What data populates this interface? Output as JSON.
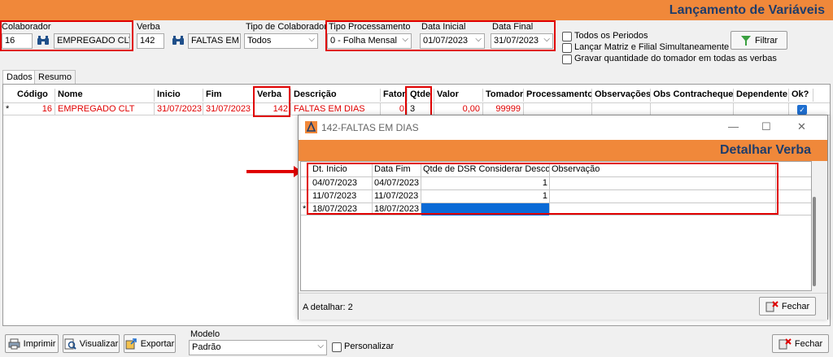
{
  "header": {
    "title": "Lançamento de Variáveis"
  },
  "form": {
    "colaborador": {
      "label": "Colaborador",
      "code": "16",
      "name": "EMPREGADO CLT"
    },
    "verba": {
      "label": "Verba",
      "code": "142",
      "name": "FALTAS EM"
    },
    "tipo_colaborador": {
      "label": "Tipo de Colaborador",
      "value": "Todos"
    },
    "tipo_processamento": {
      "label": "Tipo Processamento",
      "value": "0 - Folha Mensal"
    },
    "data_inicial": {
      "label": "Data Inicial",
      "value": "01/07/2023"
    },
    "data_final": {
      "label": "Data Final",
      "value": "31/07/2023"
    },
    "options": [
      {
        "label": "Todos os Periodos",
        "checked": false
      },
      {
        "label": "Lançar Matriz e Filial Simultaneamente",
        "checked": false
      },
      {
        "label": "Gravar quantidade do tomador em todas as verbas",
        "checked": false
      }
    ],
    "filter_button": {
      "label": "Filtrar"
    }
  },
  "tabs": [
    {
      "label": "Dados",
      "active": true
    },
    {
      "label": "Resumo",
      "active": false
    }
  ],
  "grid": {
    "columns": [
      "Código",
      "Nome",
      "Inicio",
      "Fim",
      "Verba",
      "Descrição",
      "Fator",
      "Qtde",
      "Valor",
      "Tomador",
      "Processamento",
      "Observações",
      "Obs Contracheque",
      "Dependente",
      "Ok?"
    ],
    "rows": [
      {
        "marker": "*",
        "codigo": "16",
        "nome": "EMPREGADO CLT",
        "inicio": "31/07/2023",
        "fim": "31/07/2023",
        "verba": "142",
        "descricao": "FALTAS EM DIAS",
        "fator": "0",
        "qtde": "3",
        "valor": "0,00",
        "tomador": "99999",
        "processamento": "",
        "observacoes": "",
        "obs_contracheque": "",
        "dependente": "",
        "ok": true
      }
    ]
  },
  "dialog": {
    "window_title": "142-FALTAS EM DIAS",
    "header_title": "Detalhar Verba",
    "columns": [
      "Dt. Inicio",
      "Data Fim",
      "Qtde de DSR Considerar Desconto",
      "Observação"
    ],
    "rows": [
      {
        "marker": "",
        "dt_inicio": "04/07/2023",
        "data_fim": "04/07/2023",
        "qtde_dsr": "1",
        "observacao": ""
      },
      {
        "marker": "",
        "dt_inicio": "11/07/2023",
        "data_fim": "11/07/2023",
        "qtde_dsr": "1",
        "observacao": ""
      },
      {
        "marker": "*",
        "dt_inicio": "18/07/2023",
        "data_fim": "18/07/2023",
        "qtde_dsr": "",
        "observacao": ""
      }
    ],
    "footer_status": "A detalhar: 2",
    "close_button": "Fechar"
  },
  "bottom": {
    "print_button": "Imprimir",
    "view_button": "Visualizar",
    "export_button": "Exportar",
    "modelo_label": "Modelo",
    "modelo_value": "Padrão",
    "personalizar_label": "Personalizar",
    "close_button": "Fechar"
  },
  "colors": {
    "accent": "#f0883a",
    "title": "#1f3d6b",
    "highlight": "#e00000",
    "selection": "#0a6ad6"
  },
  "icons": [
    "binoculars-icon",
    "filter-icon",
    "printer-icon",
    "magnifier-icon",
    "export-icon",
    "close-door-icon",
    "app-icon"
  ]
}
